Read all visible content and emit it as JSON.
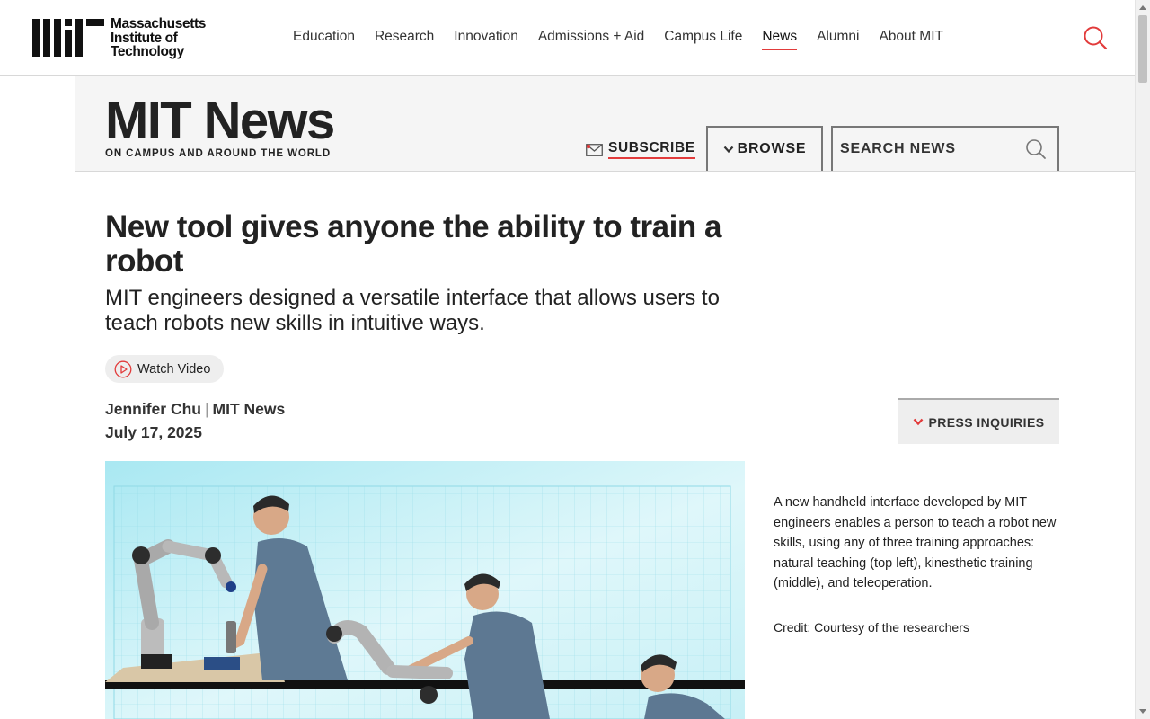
{
  "site": {
    "logo_lines": [
      "Massachusetts",
      "Institute of",
      "Technology"
    ]
  },
  "nav": {
    "items": [
      {
        "label": "Education"
      },
      {
        "label": "Research"
      },
      {
        "label": "Innovation"
      },
      {
        "label": "Admissions + Aid"
      },
      {
        "label": "Campus Life"
      },
      {
        "label": "News",
        "active": true
      },
      {
        "label": "Alumni"
      },
      {
        "label": "About MIT"
      }
    ]
  },
  "news_header": {
    "title": "MIT News",
    "tagline": "ON CAMPUS AND AROUND THE WORLD",
    "subscribe_label": "SUBSCRIBE",
    "browse_label": "BROWSE",
    "search_placeholder": "SEARCH NEWS"
  },
  "article": {
    "headline": "New tool gives anyone the ability to train a robot",
    "dek": "MIT engineers designed a versatile interface that allows users to teach robots new skills in intuitive ways.",
    "watch_video_label": "Watch Video",
    "author": "Jennifer Chu",
    "publication": "MIT News",
    "date": "July 17, 2025",
    "press_label": "PRESS INQUIRIES",
    "caption": "A new handheld interface developed by MIT engineers enables a person to teach a robot new skills, using any of three training approaches: natural teaching (top left), kinesthetic training (middle), and teleoperation.",
    "credit": "Credit: Courtesy of the researchers"
  },
  "colors": {
    "accent": "#e23b3b",
    "text": "#222222",
    "band": "#f5f5f5",
    "hero_bg": "#bfeff5"
  },
  "icons": {
    "search": "search-icon",
    "mail": "mail-icon",
    "chevron": "chevron-down-icon",
    "play": "play-circle-icon"
  }
}
